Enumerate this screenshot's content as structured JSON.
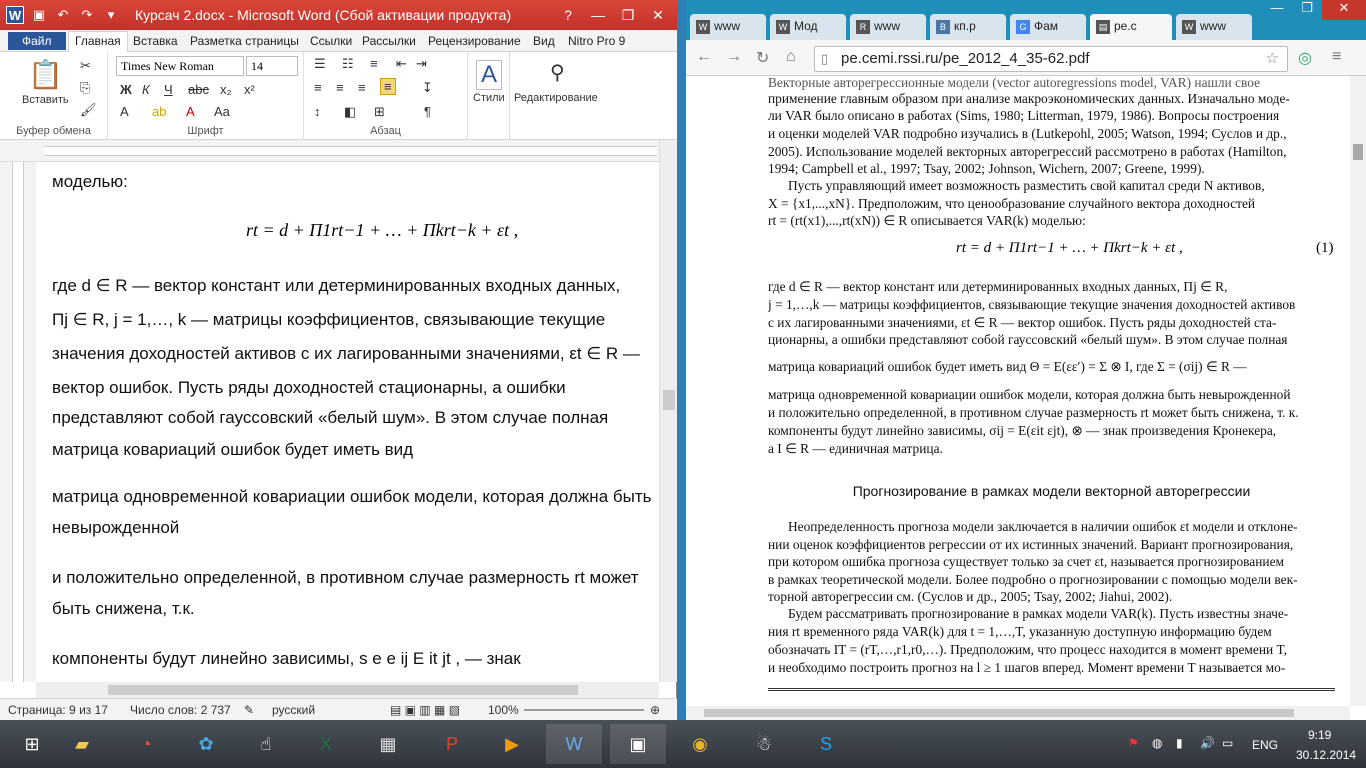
{
  "word": {
    "title": "Курсач 2.docx - Microsoft Word (Сбой активации продукта)",
    "tabs": [
      "Файл",
      "Главная",
      "Вставка",
      "Разметка страницы",
      "Ссылки",
      "Рассылки",
      "Рецензирование",
      "Вид",
      "Nitro Pro 9"
    ],
    "font_name": "Times New Roman",
    "font_size": "14",
    "groups": {
      "clipboard": "Буфер обмена",
      "font": "Шрифт",
      "paragraph": "Абзац"
    },
    "paste": "Вставить",
    "styles": "Стили",
    "editing": "Редактирование",
    "doc_lines": [
      "моделью:",
      "где d ∈ R — вектор констант или детерминированных входных данных,",
      "Πj ∈ R, j = 1,…, k  — матрицы коэффициентов, связывающие текущие",
      "значения доходностей активов с их лагированными значениями, εt ∈ R —",
      "вектор  ошибок.  Пусть  ряды  доходностей  стационарны,  а  ошибки",
      "представляют  собой  гауссовский  «белый  шум».  В этом  случае  полная",
      "матрица ковариаций ошибок будет иметь вид",
      "матрица одновременной ковариации ошибок модели, которая должна быть",
      "невырожденной",
      "и  положительно  определенной,  в  противном  случае  размерность  rt  может",
      "быть снижена, т.к.",
      "компоненты  будут  линейно  зависимы,  s  e  e  ij   E   it  jt ,     — знак"
    ],
    "equation": "rt = d + Π1rt−1 + … + Πkrt−k + εt ,",
    "status": {
      "page": "Страница: 9 из 17",
      "words": "Число слов: 2 737",
      "lang": "русский",
      "zoom": "100%"
    }
  },
  "chrome": {
    "tabs": [
      "www",
      "Мод",
      "www",
      "кп.р",
      "Фам",
      "ре.с",
      "www"
    ],
    "url": "pe.cemi.rssi.ru/pe_2012_4_35-62.pdf",
    "pdf_lines_top": [
      "применение главным образом при анализе макроэкономических данных. Изначально моде-",
      "ли VAR было описано в работах (Sims, 1980; Litterman, 1979, 1986). Вопросы построения",
      "и оценки моделей VAR подробно изучались в (Lutkepohl, 2005; Watson, 1994; Суслов и др.,",
      "2005). Использование моделей векторных авторегрессий рассмотрено в работах (Hamilton,",
      "1994; Campbell et al., 1997; Tsay, 2002; Johnson, Wichern, 2007; Greene, 1999).",
      "Пусть управляющий имеет возможность разместить свой капитал среди N активов,",
      "X = {x1,...,xN}. Предположим, что ценообразование случайного вектора доходностей",
      "rt = (rt(x1),...,rt(xN)) ∈ R описывается VAR(k) моделью:"
    ],
    "pdf_eq": "rt = d + Π1rt−1 + … + Πkrt−k + εt ,",
    "pdf_eq_num": "(1)",
    "pdf_lines_mid": [
      "где  d ∈ R — вектор констант или детерминированных входных данных,  Πj ∈ R,",
      "j = 1,…,k — матрицы коэффициентов, связывающие текущие значения доходностей активов",
      "с их лагированными значениями,  εt ∈ R — вектор ошибок. Пусть ряды доходностей ста-",
      "ционарны, а ошибки представляют собой гауссовский «белый шум». В этом случае полная",
      "матрица ковариаций ошибок будет иметь вид  Θ = E(εε′) = Σ ⊗ I, где  Σ = (σij) ∈ R —",
      "матрица одновременной ковариации ошибок модели, которая должна быть невырожденной",
      "и положительно определенной, в противном случае размерность rt может быть снижена, т. к.",
      "компоненты будут линейно зависимы,  σij = E(εit εjt),  ⊗  — знак произведения Кронекера,",
      "а  I ∈ R  — единичная матрица."
    ],
    "pdf_heading": "Прогнозирование в рамках модели векторной авторегрессии",
    "pdf_lines_bottom": [
      "Неопределенность прогноза модели заключается в наличии ошибок εt модели и отклоне-",
      "нии оценок коэффициентов регрессии от их истинных значений. Вариант прогнозирования,",
      "при котором ошибка прогноза существует только за счет εt, называется прогнозированием",
      "в рамках теоретической модели. Более подробно о прогнозировании с помощью модели век-",
      "торной авторегрессии см. (Суслов и др., 2005; Tsay, 2002; Jiahui, 2002).",
      "Будем рассматривать прогнозирование в рамках модели VAR(k). Пусть известны значе-",
      "ния rt временного ряда VAR(k) для  t = 1,…,T, указанную доступную информацию будем",
      "обозначать  IT = (rT,…,r1,r0,…). Предположим, что процесс находится в момент времени T,",
      "и необходимо построить прогноз на  l ≥ 1 шагов вперед. Момент времени T называется мо-"
    ]
  },
  "taskbar": {
    "lang": "ENG",
    "time": "9:19",
    "date": "30.12.2014"
  }
}
